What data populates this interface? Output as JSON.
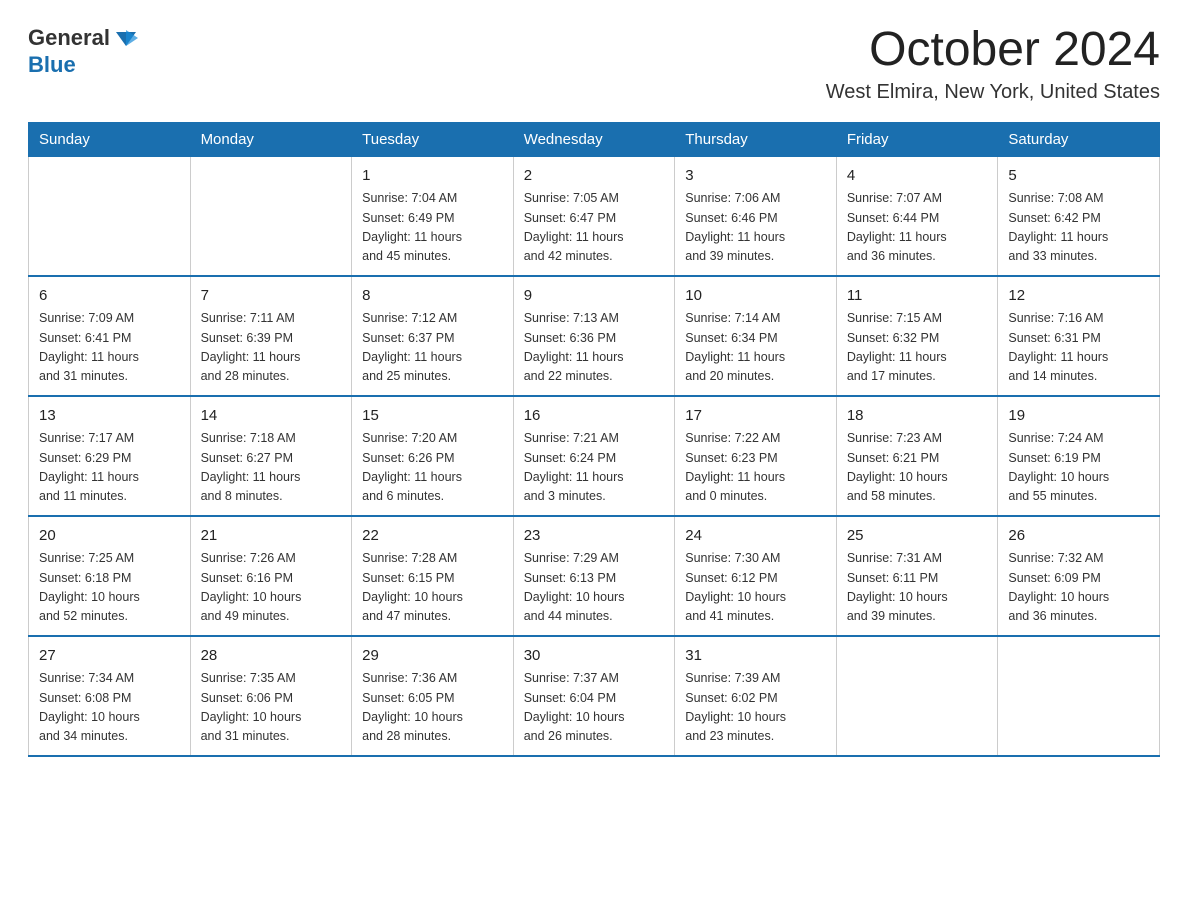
{
  "header": {
    "logo_general": "General",
    "logo_blue": "Blue",
    "month_title": "October 2024",
    "location": "West Elmira, New York, United States"
  },
  "days_of_week": [
    "Sunday",
    "Monday",
    "Tuesday",
    "Wednesday",
    "Thursday",
    "Friday",
    "Saturday"
  ],
  "weeks": [
    [
      {
        "day": "",
        "info": ""
      },
      {
        "day": "",
        "info": ""
      },
      {
        "day": "1",
        "info": "Sunrise: 7:04 AM\nSunset: 6:49 PM\nDaylight: 11 hours\nand 45 minutes."
      },
      {
        "day": "2",
        "info": "Sunrise: 7:05 AM\nSunset: 6:47 PM\nDaylight: 11 hours\nand 42 minutes."
      },
      {
        "day": "3",
        "info": "Sunrise: 7:06 AM\nSunset: 6:46 PM\nDaylight: 11 hours\nand 39 minutes."
      },
      {
        "day": "4",
        "info": "Sunrise: 7:07 AM\nSunset: 6:44 PM\nDaylight: 11 hours\nand 36 minutes."
      },
      {
        "day": "5",
        "info": "Sunrise: 7:08 AM\nSunset: 6:42 PM\nDaylight: 11 hours\nand 33 minutes."
      }
    ],
    [
      {
        "day": "6",
        "info": "Sunrise: 7:09 AM\nSunset: 6:41 PM\nDaylight: 11 hours\nand 31 minutes."
      },
      {
        "day": "7",
        "info": "Sunrise: 7:11 AM\nSunset: 6:39 PM\nDaylight: 11 hours\nand 28 minutes."
      },
      {
        "day": "8",
        "info": "Sunrise: 7:12 AM\nSunset: 6:37 PM\nDaylight: 11 hours\nand 25 minutes."
      },
      {
        "day": "9",
        "info": "Sunrise: 7:13 AM\nSunset: 6:36 PM\nDaylight: 11 hours\nand 22 minutes."
      },
      {
        "day": "10",
        "info": "Sunrise: 7:14 AM\nSunset: 6:34 PM\nDaylight: 11 hours\nand 20 minutes."
      },
      {
        "day": "11",
        "info": "Sunrise: 7:15 AM\nSunset: 6:32 PM\nDaylight: 11 hours\nand 17 minutes."
      },
      {
        "day": "12",
        "info": "Sunrise: 7:16 AM\nSunset: 6:31 PM\nDaylight: 11 hours\nand 14 minutes."
      }
    ],
    [
      {
        "day": "13",
        "info": "Sunrise: 7:17 AM\nSunset: 6:29 PM\nDaylight: 11 hours\nand 11 minutes."
      },
      {
        "day": "14",
        "info": "Sunrise: 7:18 AM\nSunset: 6:27 PM\nDaylight: 11 hours\nand 8 minutes."
      },
      {
        "day": "15",
        "info": "Sunrise: 7:20 AM\nSunset: 6:26 PM\nDaylight: 11 hours\nand 6 minutes."
      },
      {
        "day": "16",
        "info": "Sunrise: 7:21 AM\nSunset: 6:24 PM\nDaylight: 11 hours\nand 3 minutes."
      },
      {
        "day": "17",
        "info": "Sunrise: 7:22 AM\nSunset: 6:23 PM\nDaylight: 11 hours\nand 0 minutes."
      },
      {
        "day": "18",
        "info": "Sunrise: 7:23 AM\nSunset: 6:21 PM\nDaylight: 10 hours\nand 58 minutes."
      },
      {
        "day": "19",
        "info": "Sunrise: 7:24 AM\nSunset: 6:19 PM\nDaylight: 10 hours\nand 55 minutes."
      }
    ],
    [
      {
        "day": "20",
        "info": "Sunrise: 7:25 AM\nSunset: 6:18 PM\nDaylight: 10 hours\nand 52 minutes."
      },
      {
        "day": "21",
        "info": "Sunrise: 7:26 AM\nSunset: 6:16 PM\nDaylight: 10 hours\nand 49 minutes."
      },
      {
        "day": "22",
        "info": "Sunrise: 7:28 AM\nSunset: 6:15 PM\nDaylight: 10 hours\nand 47 minutes."
      },
      {
        "day": "23",
        "info": "Sunrise: 7:29 AM\nSunset: 6:13 PM\nDaylight: 10 hours\nand 44 minutes."
      },
      {
        "day": "24",
        "info": "Sunrise: 7:30 AM\nSunset: 6:12 PM\nDaylight: 10 hours\nand 41 minutes."
      },
      {
        "day": "25",
        "info": "Sunrise: 7:31 AM\nSunset: 6:11 PM\nDaylight: 10 hours\nand 39 minutes."
      },
      {
        "day": "26",
        "info": "Sunrise: 7:32 AM\nSunset: 6:09 PM\nDaylight: 10 hours\nand 36 minutes."
      }
    ],
    [
      {
        "day": "27",
        "info": "Sunrise: 7:34 AM\nSunset: 6:08 PM\nDaylight: 10 hours\nand 34 minutes."
      },
      {
        "day": "28",
        "info": "Sunrise: 7:35 AM\nSunset: 6:06 PM\nDaylight: 10 hours\nand 31 minutes."
      },
      {
        "day": "29",
        "info": "Sunrise: 7:36 AM\nSunset: 6:05 PM\nDaylight: 10 hours\nand 28 minutes."
      },
      {
        "day": "30",
        "info": "Sunrise: 7:37 AM\nSunset: 6:04 PM\nDaylight: 10 hours\nand 26 minutes."
      },
      {
        "day": "31",
        "info": "Sunrise: 7:39 AM\nSunset: 6:02 PM\nDaylight: 10 hours\nand 23 minutes."
      },
      {
        "day": "",
        "info": ""
      },
      {
        "day": "",
        "info": ""
      }
    ]
  ]
}
